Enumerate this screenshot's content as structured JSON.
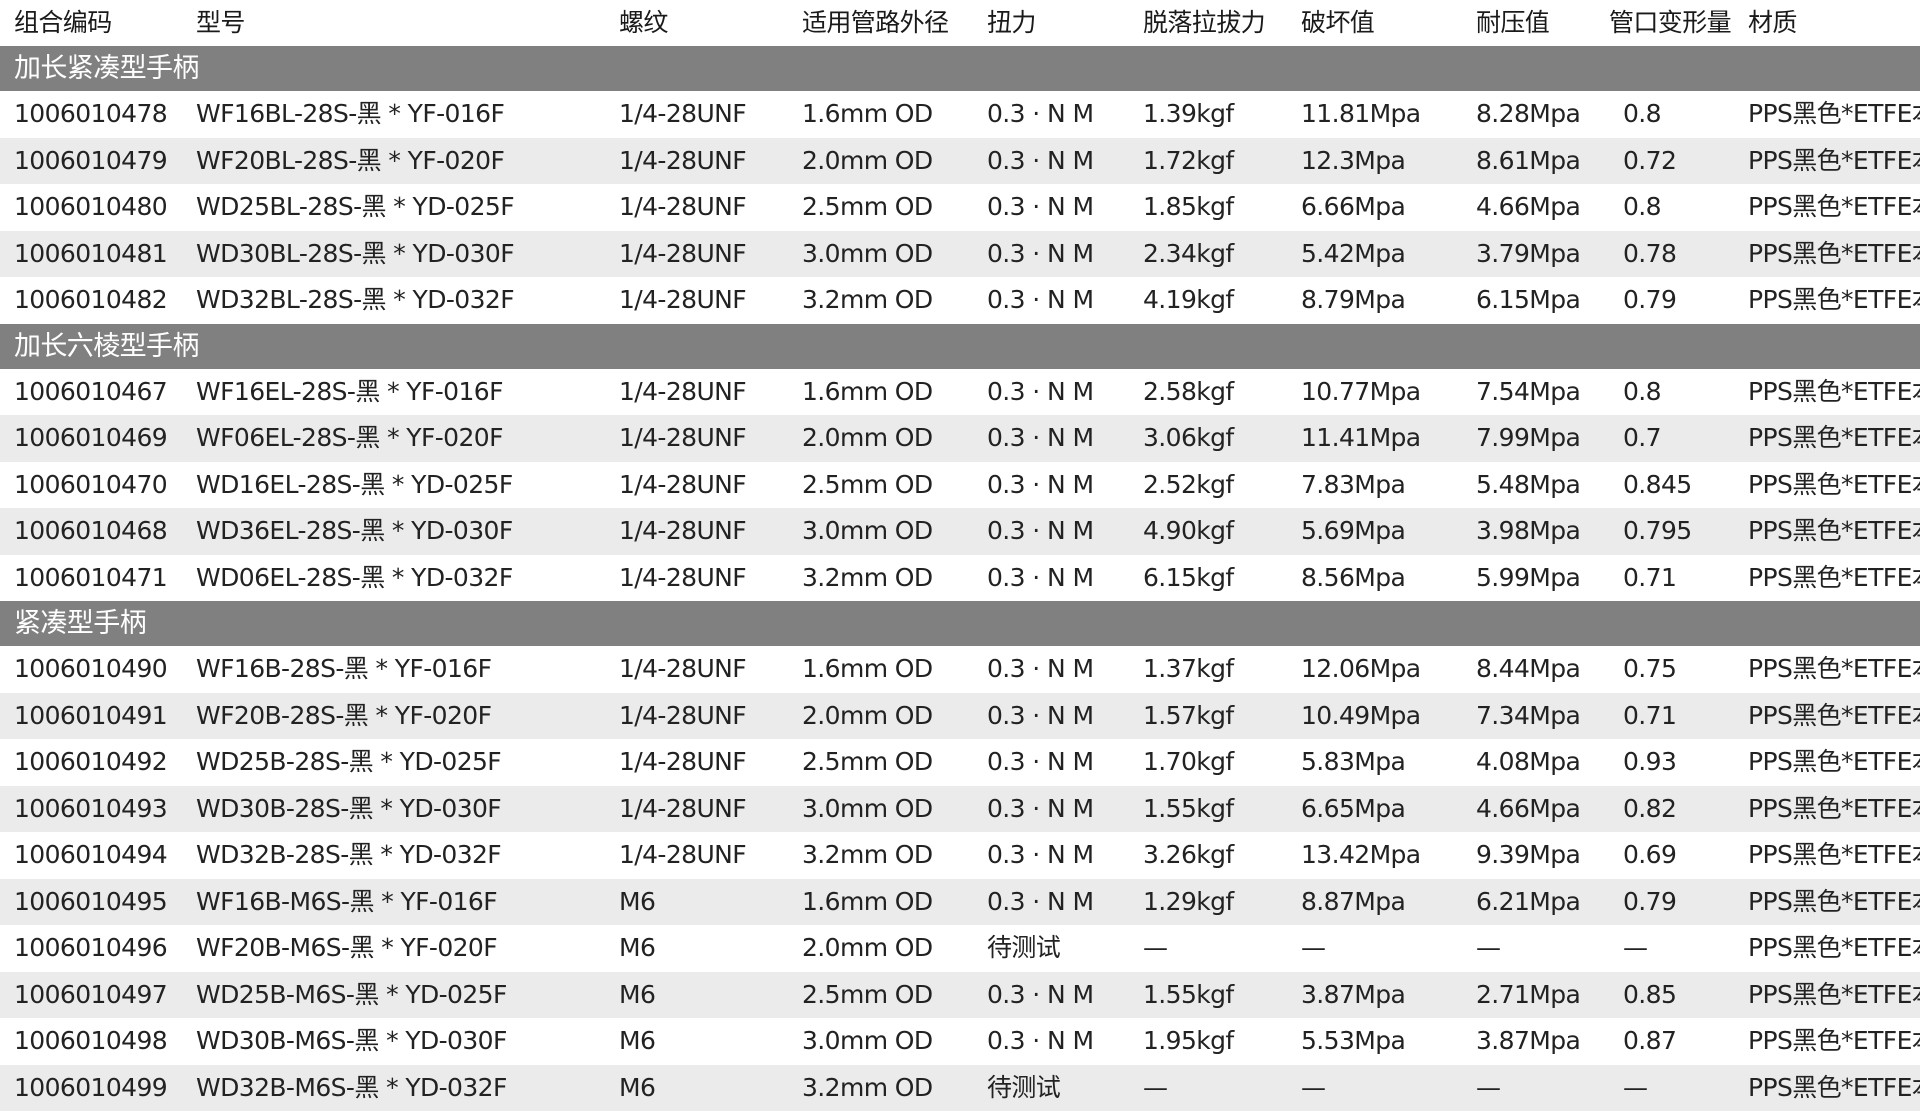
{
  "headers": [
    "组合编码",
    "型号",
    "螺纹",
    "适用管路外径",
    "扭力",
    "脱落拉拔力",
    "破坏值",
    "耐压值",
    "管口变形量",
    "材质"
  ],
  "groups": [
    {
      "name": "加长紧凑型手柄",
      "rows": [
        [
          "1006010478",
          "WF16BL-28S-黑 * YF-016F",
          "1/4-28UNF",
          "1.6mm OD",
          "0.3 · N M",
          "1.39kgf",
          "11.81Mpa",
          "8.28Mpa",
          "0.8",
          "PPS黑色*ETFE本色"
        ],
        [
          "1006010479",
          "WF20BL-28S-黑 * YF-020F",
          "1/4-28UNF",
          "2.0mm OD",
          "0.3 · N M",
          "1.72kgf",
          "12.3Mpa",
          "8.61Mpa",
          "0.72",
          "PPS黑色*ETFE本色"
        ],
        [
          "1006010480",
          "WD25BL-28S-黑 * YD-025F",
          "1/4-28UNF",
          "2.5mm OD",
          "0.3 · N M",
          "1.85kgf",
          "6.66Mpa",
          "4.66Mpa",
          "0.8",
          "PPS黑色*ETFE本色"
        ],
        [
          "1006010481",
          "WD30BL-28S-黑 * YD-030F",
          "1/4-28UNF",
          "3.0mm OD",
          "0.3 · N M",
          "2.34kgf",
          "5.42Mpa",
          "3.79Mpa",
          "0.78",
          "PPS黑色*ETFE本色"
        ],
        [
          "1006010482",
          "WD32BL-28S-黑 * YD-032F",
          "1/4-28UNF",
          "3.2mm OD",
          "0.3 · N M",
          "4.19kgf",
          "8.79Mpa",
          "6.15Mpa",
          "0.79",
          "PPS黑色*ETFE本色"
        ]
      ]
    },
    {
      "name": "加长六棱型手柄",
      "rows": [
        [
          "1006010467",
          "WF16EL-28S-黑 * YF-016F",
          "1/4-28UNF",
          "1.6mm OD",
          "0.3 · N M",
          "2.58kgf",
          "10.77Mpa",
          "7.54Mpa",
          "0.8",
          "PPS黑色*ETFE本色"
        ],
        [
          "1006010469",
          "WF06EL-28S-黑 * YF-020F",
          "1/4-28UNF",
          "2.0mm OD",
          "0.3 · N M",
          "3.06kgf",
          "11.41Mpa",
          "7.99Mpa",
          "0.7",
          "PPS黑色*ETFE本色"
        ],
        [
          "1006010470",
          "WD16EL-28S-黑 * YD-025F",
          "1/4-28UNF",
          "2.5mm OD",
          "0.3 · N M",
          "2.52kgf",
          "7.83Mpa",
          "5.48Mpa",
          "0.845",
          "PPS黑色*ETFE本色"
        ],
        [
          "1006010468",
          "WD36EL-28S-黑 * YD-030F",
          "1/4-28UNF",
          "3.0mm OD",
          "0.3 · N M",
          "4.90kgf",
          "5.69Mpa",
          "3.98Mpa",
          "0.795",
          "PPS黑色*ETFE本色"
        ],
        [
          "1006010471",
          "WD06EL-28S-黑 * YD-032F",
          "1/4-28UNF",
          "3.2mm OD",
          "0.3 · N M",
          "6.15kgf",
          "8.56Mpa",
          "5.99Mpa",
          "0.71",
          "PPS黑色*ETFE本色"
        ]
      ]
    },
    {
      "name": "紧凑型手柄",
      "rows": [
        [
          "1006010490",
          "WF16B-28S-黑 * YF-016F",
          "1/4-28UNF",
          "1.6mm OD",
          "0.3 · N M",
          "1.37kgf",
          "12.06Mpa",
          "8.44Mpa",
          "0.75",
          "PPS黑色*ETFE本色"
        ],
        [
          "1006010491",
          "WF20B-28S-黑 * YF-020F",
          "1/4-28UNF",
          "2.0mm OD",
          "0.3 · N M",
          "1.57kgf",
          "10.49Mpa",
          "7.34Mpa",
          "0.71",
          "PPS黑色*ETFE本色"
        ],
        [
          "1006010492",
          "WD25B-28S-黑 * YD-025F",
          "1/4-28UNF",
          "2.5mm OD",
          "0.3 · N M",
          "1.70kgf",
          "5.83Mpa",
          "4.08Mpa",
          "0.93",
          "PPS黑色*ETFE本色"
        ],
        [
          "1006010493",
          "WD30B-28S-黑 * YD-030F",
          "1/4-28UNF",
          "3.0mm OD",
          "0.3 · N M",
          "1.55kgf",
          "6.65Mpa",
          "4.66Mpa",
          "0.82",
          "PPS黑色*ETFE本色"
        ],
        [
          "1006010494",
          "WD32B-28S-黑 * YD-032F",
          "1/4-28UNF",
          "3.2mm OD",
          "0.3 · N M",
          "3.26kgf",
          "13.42Mpa",
          "9.39Mpa",
          "0.69",
          "PPS黑色*ETFE本色"
        ],
        [
          "1006010495",
          "WF16B-M6S-黑 * YF-016F",
          "M6",
          "1.6mm OD",
          "0.3 · N M",
          "1.29kgf",
          "8.87Mpa",
          "6.21Mpa",
          "0.79",
          "PPS黑色*ETFE本色"
        ],
        [
          "1006010496",
          "WF20B-M6S-黑 * YF-020F",
          "M6",
          "2.0mm OD",
          "待测试",
          "—",
          "—",
          "—",
          "—",
          "PPS黑色*ETFE本色"
        ],
        [
          "1006010497",
          "WD25B-M6S-黑 * YD-025F",
          "M6",
          "2.5mm OD",
          "0.3 · N M",
          "1.55kgf",
          "3.87Mpa",
          "2.71Mpa",
          "0.85",
          "PPS黑色*ETFE本色"
        ],
        [
          "1006010498",
          "WD30B-M6S-黑 * YD-030F",
          "M6",
          "3.0mm OD",
          "0.3 · N M",
          "1.95kgf",
          "5.53Mpa",
          "3.87Mpa",
          "0.87",
          "PPS黑色*ETFE本色"
        ],
        [
          "1006010499",
          "WD32B-M6S-黑 * YD-032F",
          "M6",
          "3.2mm OD",
          "待测试",
          "—",
          "—",
          "—",
          "—",
          "PPS黑色*ETFE本色"
        ]
      ]
    }
  ],
  "colors": {
    "group_bg": "#808080",
    "group_text": "#ffffff",
    "stripe": "#ebebeb",
    "text": "#222222"
  }
}
